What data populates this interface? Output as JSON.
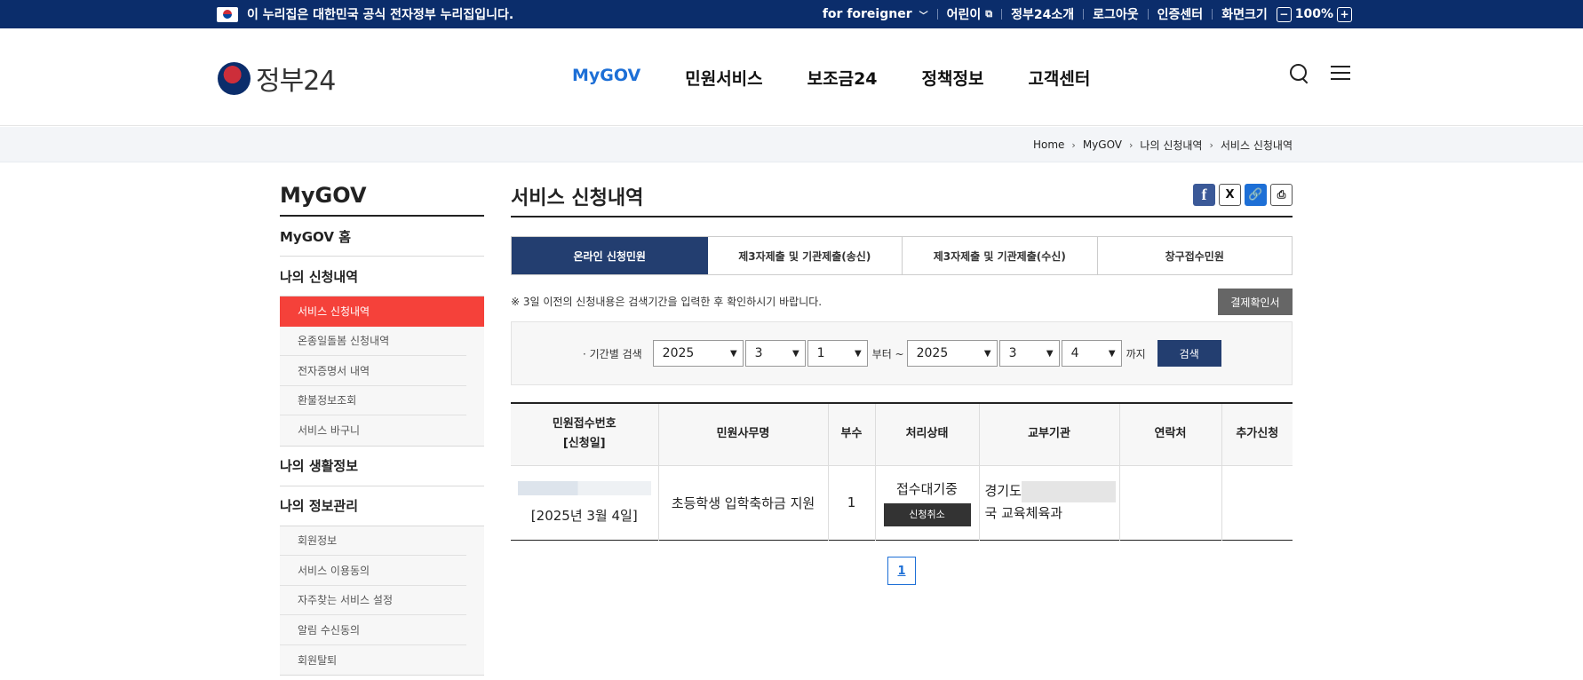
{
  "topbar": {
    "notice": "이 누리집은 대한민국 공식 전자정부 누리집입니다.",
    "foreigner": "for foreigner",
    "kids": "어린이",
    "intro": "정부24소개",
    "logout": "로그아웃",
    "cert": "인증센터",
    "screen_size": "화면크기",
    "zoom_minus": "−",
    "zoom": "100%",
    "zoom_plus": "+"
  },
  "header": {
    "logo_text": "정부24",
    "nav": [
      "MyGOV",
      "민원서비스",
      "보조금24",
      "정책정보",
      "고객센터"
    ]
  },
  "breadcrumb": [
    "Home",
    "MyGOV",
    "나의 신청내역",
    "서비스 신청내역"
  ],
  "lnb": {
    "title": "MyGOV",
    "home": "MyGOV 홈",
    "my_applications": "나의 신청내역",
    "app_items": [
      "서비스 신청내역",
      "온종일돌봄 신청내역",
      "전자증명서 내역",
      "환불정보조회",
      "서비스 바구니"
    ],
    "life_info": "나의 생활정보",
    "info_mgmt": "나의 정보관리",
    "mgmt_items": [
      "회원정보",
      "서비스 이용동의",
      "자주찾는 서비스 설정",
      "알림 수신동의",
      "회원탈퇴"
    ]
  },
  "content": {
    "title": "서비스 신청내역",
    "share": {
      "facebook": "f",
      "x": "X",
      "link": "🔗",
      "print": "⎙"
    },
    "tabs": [
      "온라인 신청민원",
      "제3자제출 및 기관제출(송신)",
      "제3자제출 및 기관제출(수신)",
      "창구접수민원"
    ],
    "note": "※ 3일 이전의 신청내용은 검색기간을 입력한 후 확인하시기 바랍니다.",
    "receipt_button": "결제확인서",
    "search": {
      "label": "· 기간별 검색",
      "from_year": "2025",
      "from_month": "3",
      "from_day": "1",
      "from_text": "부터 ~",
      "to_year": "2025",
      "to_month": "3",
      "to_day": "4",
      "to_text": "까지",
      "button": "검색"
    },
    "table": {
      "headers": [
        "민원접수번호",
        "[신청일]",
        "민원사무명",
        "부수",
        "처리상태",
        "교부기관",
        "연락처",
        "추가신청"
      ],
      "row": {
        "date": "[2025년 3월 4일]",
        "service": "초등학생 입학축하금 지원",
        "count": "1",
        "status": "접수대기중",
        "cancel": "신청취소",
        "org_prefix": "경기도",
        "org_suffix": "국 교육체육과"
      }
    },
    "page": "1"
  }
}
